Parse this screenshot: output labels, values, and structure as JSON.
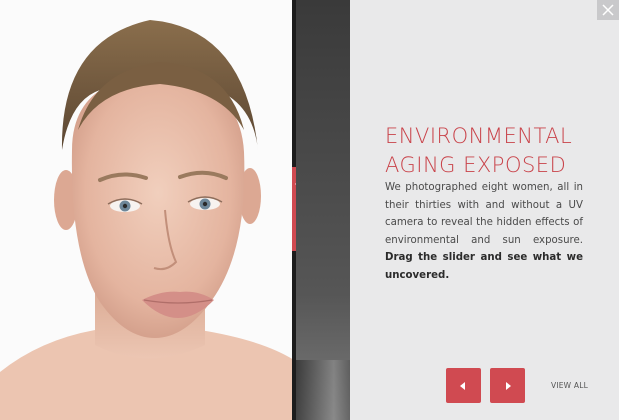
{
  "panel": {
    "title_line1": "ENVIRONMENTAL",
    "title_line2": "AGING EXPOSED",
    "description": "We photographed eight women, all in their thirties with and without a UV camera to reveal the hidden effects of environmental and sun exposure.",
    "description_bold": "Drag the slider and see what we uncovered."
  },
  "navigation": {
    "view_all_label": "VIEW ALL"
  },
  "icons": {
    "close": "close-icon",
    "prev": "arrow-left-icon",
    "next": "arrow-right-icon"
  },
  "colors": {
    "accent": "#d04a51",
    "title": "#c9434a",
    "panel_bg": "#e9e9ea"
  }
}
